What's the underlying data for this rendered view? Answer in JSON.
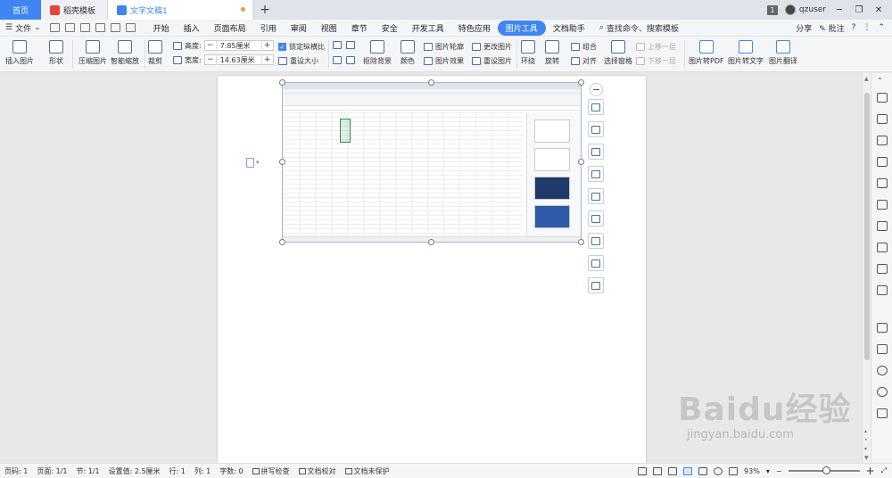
{
  "tabs": {
    "home": "首页",
    "tab2": "稻壳模板",
    "tab3": "文字文稿1",
    "badge": "1",
    "user": "qzuser"
  },
  "menu": {
    "file": "文件",
    "items": [
      "开始",
      "插入",
      "页面布局",
      "引用",
      "审阅",
      "视图",
      "章节",
      "安全",
      "开发工具",
      "特色应用",
      "图片工具",
      "文档助手"
    ],
    "active_index": 10,
    "search": "查找命令、搜索模板",
    "share": "分享",
    "comment": "批注"
  },
  "ribbon": {
    "insert_pic": "插入图片",
    "shape": "形状",
    "compress": "压缩图片",
    "smart_scale": "智能缩放",
    "crop": "裁剪",
    "height_label": "高度:",
    "height_value": "7.85厘米",
    "width_label": "宽度:",
    "width_value": "14.63厘米",
    "lock_ratio": "锁定纵横比",
    "reset_size": "重设大小",
    "remove_bg": "抠除背景",
    "color": "颜色",
    "pic_outline": "图片轮廓",
    "pic_effect": "图片效果",
    "change_pic": "更改图片",
    "reset_pic": "重设图片",
    "wrap": "环绕",
    "rotate": "旋转",
    "group": "组合",
    "align": "对齐",
    "select_pane": "选择窗格",
    "bring_forward": "上移一层",
    "send_backward": "下移一层",
    "to_pdf": "图片转PDF",
    "to_text": "图片转文字",
    "translate": "图片翻译"
  },
  "status": {
    "page": "页码: 1",
    "pages": "页面: 1/1",
    "section": "节: 1/1",
    "setting": "设置值: 2.5厘米",
    "row": "行: 1",
    "col": "列: 1",
    "words": "字数: 0",
    "spell": "拼写检查",
    "proof": "文档校对",
    "protect": "文档未保护",
    "zoom": "93%"
  },
  "watermark": {
    "brand": "Baidu经验",
    "url": "jingyan.baidu.com"
  }
}
